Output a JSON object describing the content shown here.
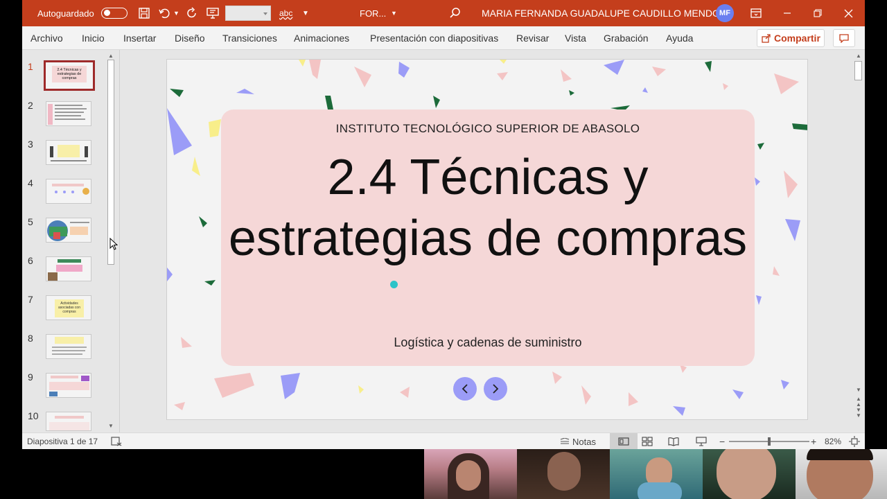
{
  "titlebar": {
    "autosave_label": "Autoguardado",
    "doc_name": "FOR...",
    "user_name": "MARIA FERNANDA GUADALUPE CAUDILLO MENDOZA",
    "user_initials": "MF",
    "accent_color": "#c43e1c"
  },
  "menu": {
    "tabs": [
      "Archivo",
      "Inicio",
      "Insertar",
      "Diseño",
      "Transiciones",
      "Animaciones",
      "Presentación con diapositivas",
      "Revisar",
      "Vista",
      "Grabación",
      "Ayuda"
    ],
    "share_label": "Compartir"
  },
  "thumbnails": {
    "numbers": [
      "1",
      "2",
      "3",
      "4",
      "5",
      "6",
      "7",
      "8",
      "9",
      "10"
    ],
    "selected": "1",
    "t1_text": "2.4 Técnicas y estrategias de compras",
    "t7_text": "Actividades asociadas con compras"
  },
  "slide": {
    "institution": "INSTITUTO TECNOLÓGICO SUPERIOR DE ABASOLO",
    "title": "2.4 Técnicas y estrategias de compras",
    "subtitle": "Logística y cadenas de suministro",
    "card_color": "#f5d7d7",
    "nav_color": "#9b9cf7"
  },
  "status": {
    "slide_counter": "Diapositiva 1 de 17",
    "notes_label": "Notas",
    "zoom": "82%"
  }
}
